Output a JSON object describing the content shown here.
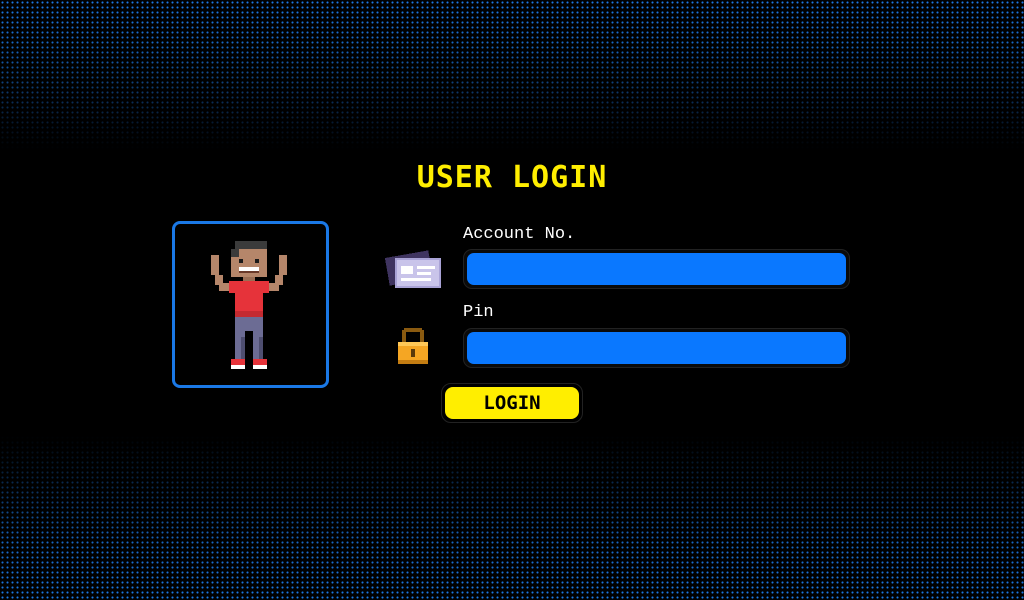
{
  "login": {
    "title": "USER LOGIN",
    "account_label": "Account No.",
    "account_value": "",
    "pin_label": "Pin",
    "pin_value": "",
    "button_label": "LOGIN"
  },
  "icons": {
    "avatar": "pixel-character-avatar",
    "account": "id-card-icon",
    "pin": "padlock-icon"
  },
  "colors": {
    "background": "#000000",
    "accent_blue": "#1a78e6",
    "input_fill": "#0a78ff",
    "title_yellow": "#ffee00",
    "button_yellow": "#ffee00"
  }
}
